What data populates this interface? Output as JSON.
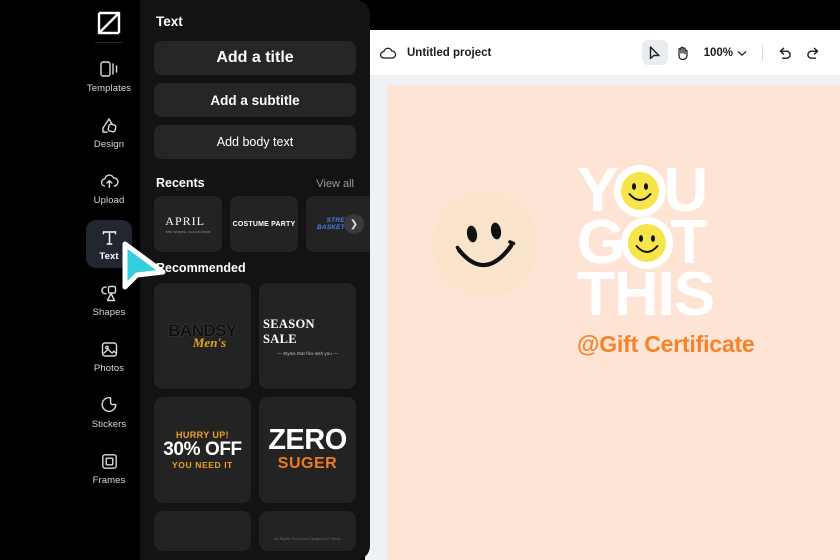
{
  "app": {
    "logo_icon": "capcut-logo-icon"
  },
  "rail": {
    "items": [
      {
        "label": "Templates",
        "icon": "templates-icon",
        "active": false
      },
      {
        "label": "Design",
        "icon": "design-icon",
        "active": false
      },
      {
        "label": "Upload",
        "icon": "upload-cloud-icon",
        "active": false
      },
      {
        "label": "Text",
        "icon": "text-t-icon",
        "active": true
      },
      {
        "label": "Shapes",
        "icon": "shapes-icon",
        "active": false
      },
      {
        "label": "Photos",
        "icon": "photos-image-icon",
        "active": false
      },
      {
        "label": "Stickers",
        "icon": "stickers-icon",
        "active": false
      },
      {
        "label": "Frames",
        "icon": "frames-icon",
        "active": false
      }
    ]
  },
  "panel": {
    "title": "Text",
    "buttons": [
      {
        "label": "Add a title"
      },
      {
        "label": "Add a subtitle"
      },
      {
        "label": "Add body text"
      }
    ],
    "recents": {
      "title": "Recents",
      "view_all": "View all",
      "next_icon": "chevron-right-icon",
      "items": [
        {
          "name": "APRIL",
          "sub": "THE SPRING COLLECTION"
        },
        {
          "name": "COSTUME PARTY",
          "sub": ""
        },
        {
          "name": "STREET BASKETBALL",
          "sub": ""
        }
      ]
    },
    "recommended": {
      "title": "Recommended",
      "items": [
        {
          "line1": "BANDSY",
          "line2": "Men's",
          "line3": ""
        },
        {
          "line1": "SEASON SALE",
          "line2": "— Styles that flex with you —",
          "line3": ""
        },
        {
          "line1": "HURRY UP!",
          "line2": "30% OFF",
          "line3": "YOU NEED IT"
        },
        {
          "line1": "ZERO",
          "line2": "SUGER",
          "line3": ""
        }
      ],
      "partial_credit": "All Rights Reserved Designed of Tiktok"
    }
  },
  "editor": {
    "cloud_icon": "cloud-save-icon",
    "project_name": "Untitled project",
    "tools": [
      {
        "name": "select-cursor-tool",
        "icon": "cursor-arrow-icon",
        "selected": true
      },
      {
        "name": "hand-pan-tool",
        "icon": "hand-icon",
        "selected": false
      }
    ],
    "zoom": {
      "value": "100%",
      "chevron_icon": "chevron-down-icon"
    },
    "history": [
      {
        "name": "undo-button",
        "icon": "undo-arrow-icon"
      },
      {
        "name": "redo-button",
        "icon": "redo-arrow-icon"
      }
    ]
  },
  "canvas": {
    "background_color": "#fde4d5",
    "pale_smiley_color": "#fae4cb",
    "smiley_yellow": "#f5e54a",
    "headline_color": "#ffffff",
    "accent_color": "#f5832a",
    "line1_a": "Y",
    "line1_b": "U",
    "line2_a": "G",
    "line2_b": "T",
    "line3": "THIS",
    "tagline": "@Gift Certificate"
  },
  "cursor": {
    "icon": "mouse-pointer-cursor",
    "color": "#35cde0"
  }
}
